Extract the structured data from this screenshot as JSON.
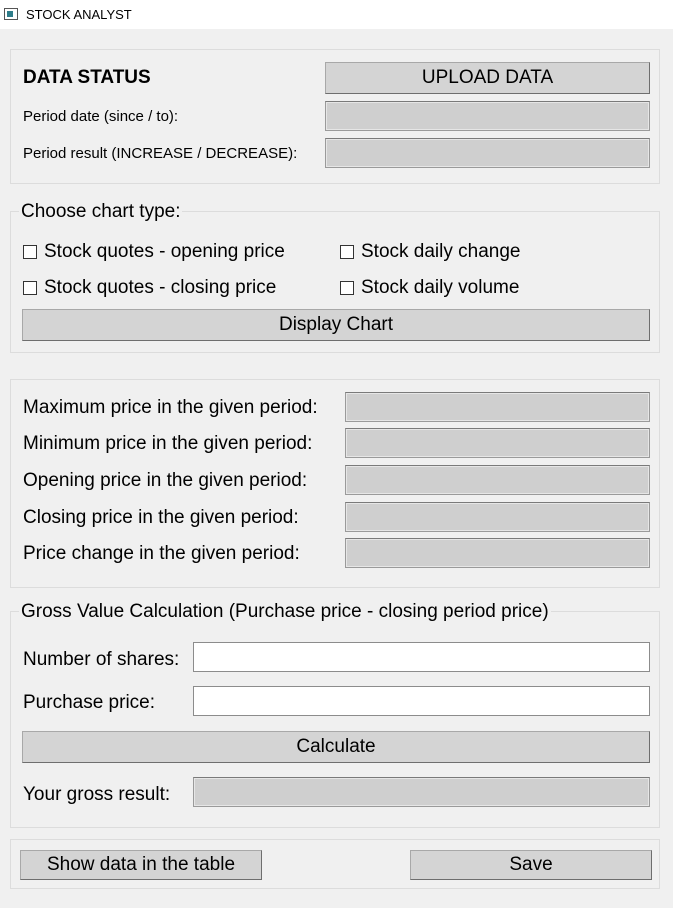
{
  "window": {
    "title": "STOCK ANALYST"
  },
  "status": {
    "heading": "DATA STATUS",
    "upload_label": "UPLOAD DATA",
    "period_date_label": "Period date (since / to):",
    "period_result_label": "Period result (INCREASE / DECREASE):"
  },
  "chart": {
    "title": "Choose chart type:",
    "options": [
      "Stock quotes - opening price",
      "Stock daily change",
      "Stock quotes - closing price",
      "Stock daily volume"
    ],
    "display_label": "Display Chart"
  },
  "prices": {
    "max_label": "Maximum price in the given period:",
    "min_label": "Minimum price in the given period:",
    "open_label": "Opening price in the given period:",
    "close_label": "Closing price in the given period:",
    "change_label": "Price change in the given period:"
  },
  "gross": {
    "title": "Gross Value Calculation (Purchase price - closing period price)",
    "shares_label": "Number of shares:",
    "purchase_label": "Purchase price:",
    "calculate_label": "Calculate",
    "result_label": "Your gross result:"
  },
  "footer": {
    "show_table_label": "Show data in the table",
    "save_label": "Save"
  }
}
